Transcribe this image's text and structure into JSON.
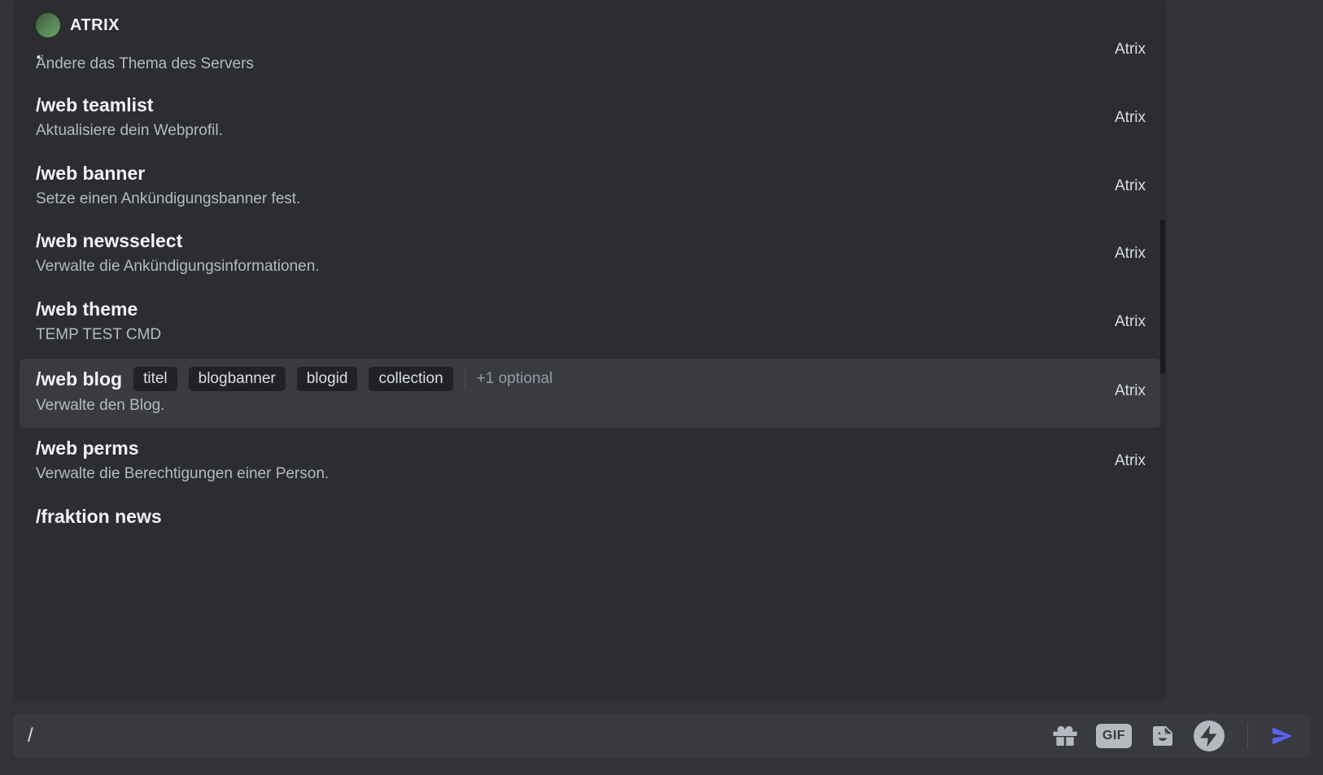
{
  "bot": {
    "name": "ATRIX"
  },
  "partial_top": {
    "dot": ".",
    "desc": "Ändere das Thema des Servers",
    "source": "Atrix"
  },
  "commands": [
    {
      "name": "/web teamlist",
      "desc": "Aktualisiere dein Webprofil.",
      "source": "Atrix",
      "params": [],
      "optional": "",
      "selected": false
    },
    {
      "name": "/web banner",
      "desc": "Setze einen Ankündigungsbanner fest.",
      "source": "Atrix",
      "params": [],
      "optional": "",
      "selected": false
    },
    {
      "name": "/web newsselect",
      "desc": "Verwalte die Ankündigungsinformationen.",
      "source": "Atrix",
      "params": [],
      "optional": "",
      "selected": false
    },
    {
      "name": "/web theme",
      "desc": "TEMP TEST CMD",
      "source": "Atrix",
      "params": [],
      "optional": "",
      "selected": false
    },
    {
      "name": "/web blog",
      "desc": "Verwalte den Blog.",
      "source": "Atrix",
      "params": [
        "titel",
        "blogbanner",
        "blogid",
        "collection"
      ],
      "optional": "+1 optional",
      "selected": true
    },
    {
      "name": "/web perms",
      "desc": "Verwalte die Berechtigungen einer Person.",
      "source": "Atrix",
      "params": [],
      "optional": "",
      "selected": false
    }
  ],
  "partial_bottom": {
    "name": "/fraktion news"
  },
  "input": {
    "text": "/"
  },
  "gif_label": "GIF"
}
